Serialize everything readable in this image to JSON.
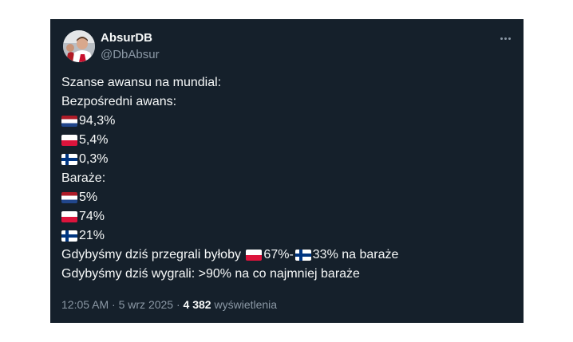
{
  "author": {
    "name": "AbsurDB",
    "handle": "@DbAbsur"
  },
  "tweet": {
    "line1": "Szanse awansu na mundial:",
    "line2": "Bezpośredni awans:",
    "direct": [
      {
        "flag": "netherlands-flag-icon",
        "value": "94,3%"
      },
      {
        "flag": "poland-flag-icon",
        "value": "5,4%"
      },
      {
        "flag": "finland-flag-icon",
        "value": "0,3%"
      }
    ],
    "playoffs_label": "Baraże:",
    "playoffs": [
      {
        "flag": "netherlands-flag-icon",
        "value": "5%"
      },
      {
        "flag": "poland-flag-icon",
        "value": "74%"
      },
      {
        "flag": "finland-flag-icon",
        "value": "21%"
      }
    ],
    "lose_prefix": "Gdybyśmy dziś przegrali byłoby ",
    "lose_pl": "67%-",
    "lose_fi": "33% na baraże",
    "win_line": "Gdybyśmy dziś wygrali: >90% na co najmniej baraże"
  },
  "meta": {
    "time": "12:05 AM",
    "sep1": " · ",
    "date": "5 wrz 2025",
    "sep2": " · ",
    "views": "4 382",
    "views_label": " wyświetlenia"
  },
  "colors": {
    "background": "#15202b",
    "text": "#f7f9f9",
    "secondary": "#8b98a5"
  }
}
